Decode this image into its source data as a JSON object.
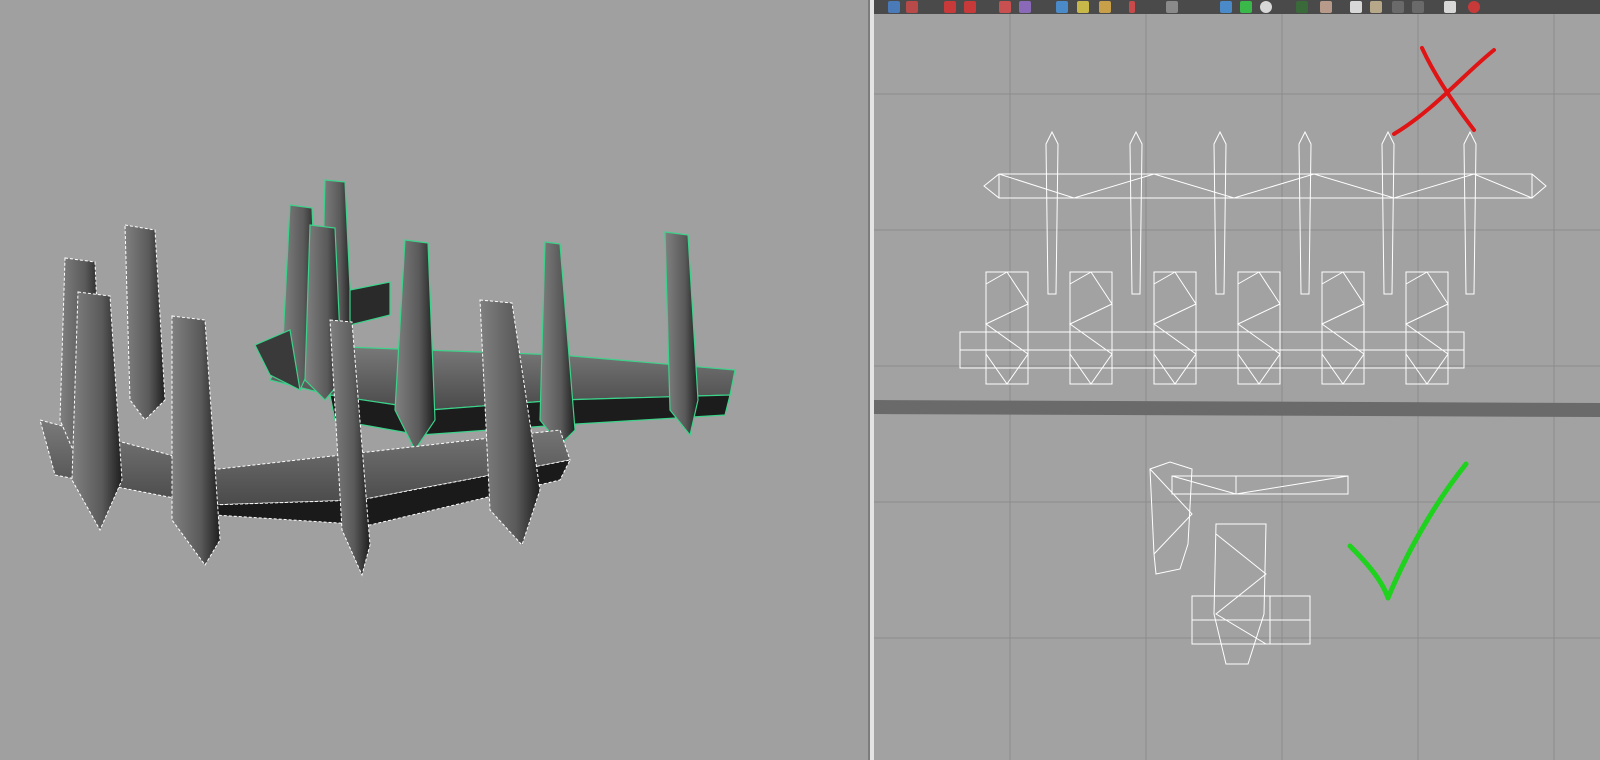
{
  "viewport_3d": {
    "name": "perspective-viewport",
    "selection_color": "#3cd28a",
    "mesh_color": "#5d5d5d"
  },
  "uv_editor": {
    "name": "uv-texture-editor",
    "grid_color": "#8c8c8c",
    "wire_color": "#ffffff",
    "toolbar_icons": [
      "grid-icon",
      "frame-icon",
      "flip-u-icon",
      "flip-v-icon",
      "cut-icon",
      "sew-icon",
      "move-icon",
      "snap-icon",
      "layout-icon",
      "distribute-icon",
      "arrow-icon",
      "image-icon",
      "checker-icon",
      "color-icon",
      "shaded-icon",
      "dim-icon",
      "pixel-icon",
      "settings-icon",
      "isolate-icon",
      "copy-icon",
      "paste-icon",
      "close-icon"
    ],
    "bad_mark": {
      "symbol": "cross",
      "color": "#e01414",
      "meaning": "incorrect"
    },
    "good_mark": {
      "symbol": "check",
      "color": "#1ed21e",
      "meaning": "correct"
    }
  }
}
